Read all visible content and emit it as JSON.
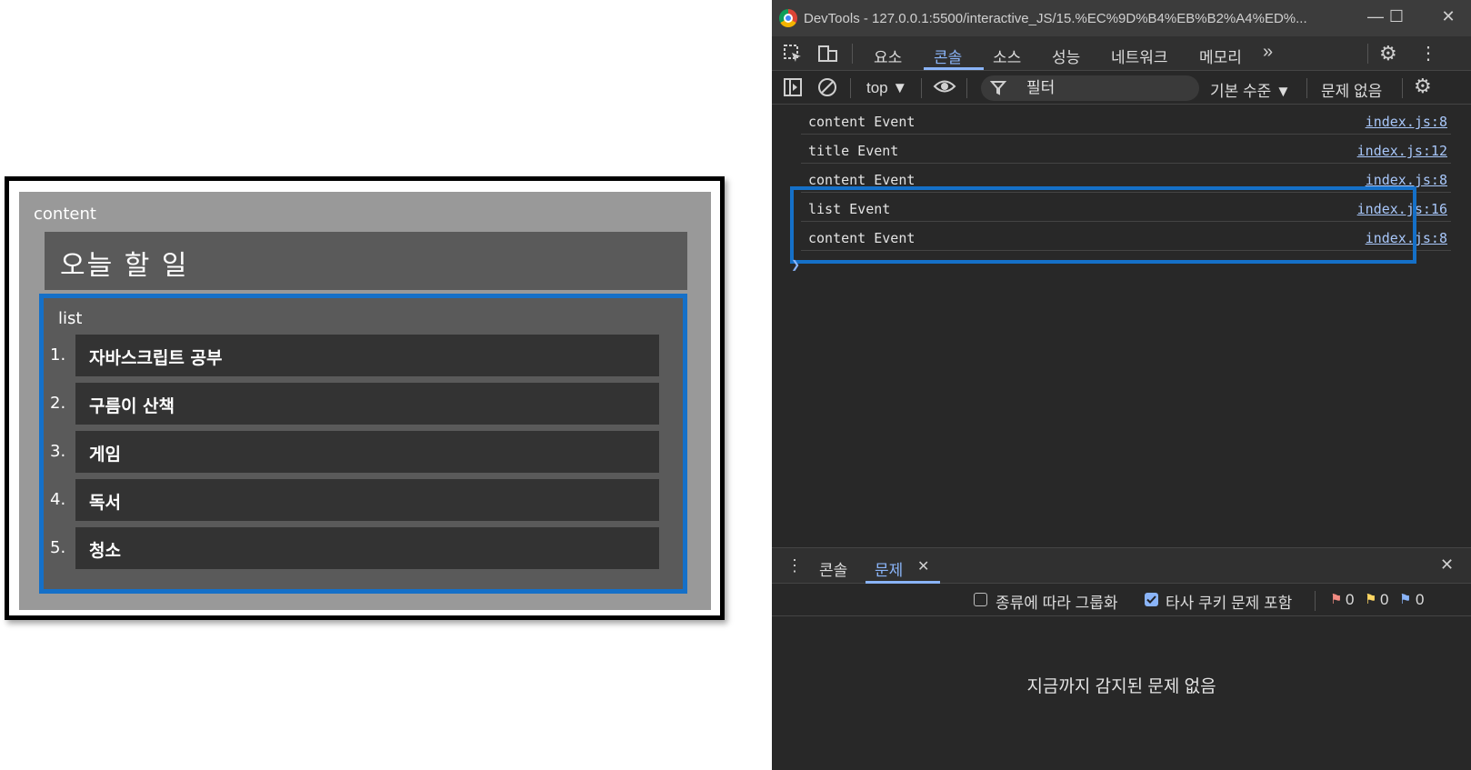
{
  "preview": {
    "content_label": "content",
    "title": "오늘 할 일",
    "list_label": "list",
    "items": [
      {
        "num": "1.",
        "text": "자바스크립트 공부"
      },
      {
        "num": "2.",
        "text": "구름이 산책"
      },
      {
        "num": "3.",
        "text": "게임"
      },
      {
        "num": "4.",
        "text": "독서"
      },
      {
        "num": "5.",
        "text": "청소"
      }
    ]
  },
  "devtools": {
    "window_title": "DevTools - 127.0.0.1:5500/interactive_JS/15.%EC%9D%B4%EB%B2%A4%ED%...",
    "tabs": [
      "요소",
      "콘솔",
      "소스",
      "성능",
      "네트워크",
      "메모리"
    ],
    "active_tab": "콘솔",
    "context": "top ▼",
    "filter_placeholder": "필터",
    "levels": "기본 수준 ▼",
    "issues_status": "문제 없음",
    "logs": [
      {
        "message": "content Event",
        "source": "index.js:8"
      },
      {
        "message": "title Event",
        "source": "index.js:12"
      },
      {
        "message": "content Event",
        "source": "index.js:8"
      },
      {
        "message": "list Event",
        "source": "index.js:16"
      },
      {
        "message": "content Event",
        "source": "index.js:8"
      }
    ],
    "drawer": {
      "tab_console": "콘솔",
      "tab_issues": "문제",
      "group_by_kind": "종류에 따라 그룹화",
      "include_third_party": "타사 쿠키 문제 포함",
      "error_count": "0",
      "warning_count": "0",
      "info_count": "0",
      "empty_message": "지금까지 감지된 문제 없음"
    },
    "colors": {
      "accent": "#8ab4f8",
      "highlight": "#1570c8"
    }
  }
}
